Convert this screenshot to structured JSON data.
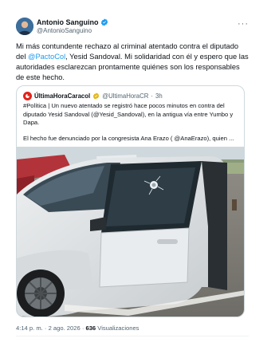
{
  "author": {
    "name": "Antonio Sanguino",
    "handle": "@AntonioSanguino",
    "more_icon": "more-horizontal-icon"
  },
  "tweet": {
    "text_before": "Mi más contundente rechazo al criminal atentado contra el diputado del ",
    "mention": "@PactoCol",
    "text_after": ", Yesid Sandoval. Mi solidaridad con él y espero que las autoridades esclarezcan prontamente quiénes son los responsables de este hecho."
  },
  "quoted": {
    "name": "ÚltimaHoraCaracol",
    "handle": "@UltimaHoraCR",
    "separator": "·",
    "time": "3h",
    "text": "#Política | Un nuevo atentado se registró hace pocos minutos en contra del diputado Yesid Sandoval (@Yesid_Sandoval), en la antigua vía entre Yumbo y Dapa.",
    "text2": "El hecho fue denunciado por la congresista Ana Erazo ( @AnaErazo), quien ..."
  },
  "meta": {
    "time": "4:14 p. m.",
    "separator": "·",
    "date": "2 ago. 2026",
    "views_count": "636",
    "views_label": "Visualizaciones"
  },
  "colors": {
    "accent": "#1d9bf0",
    "caracol_red": "#e0241b",
    "text_secondary": "#536471"
  }
}
